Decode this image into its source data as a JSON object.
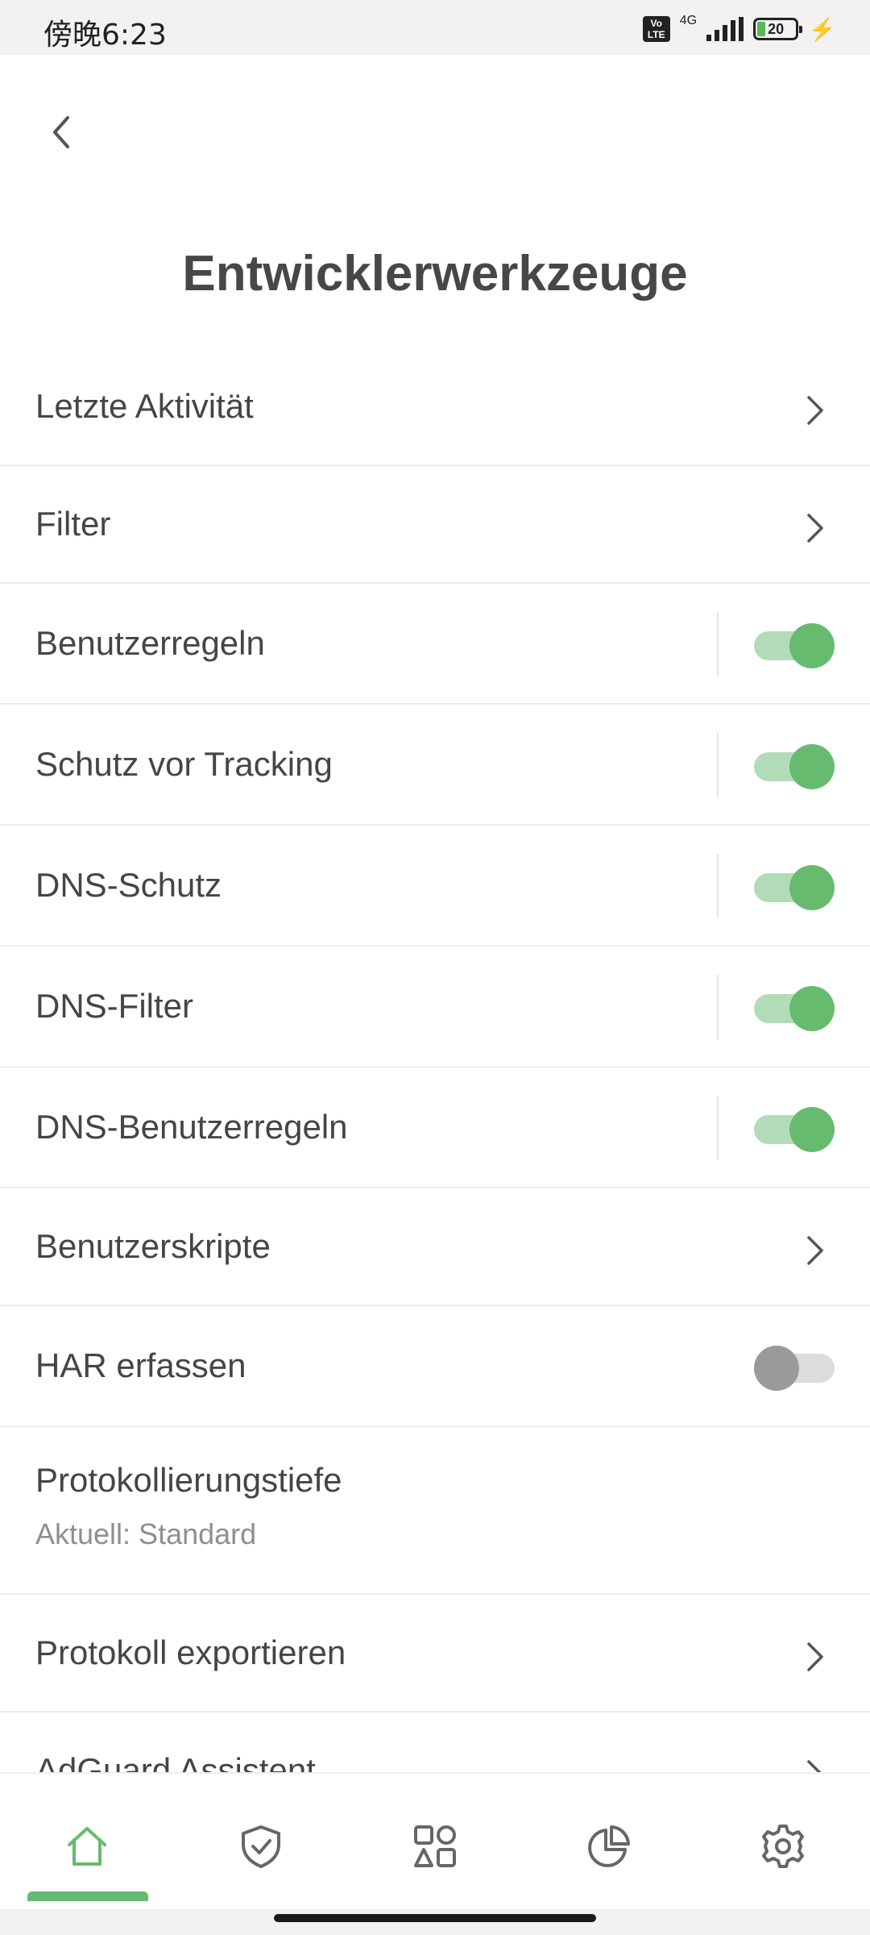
{
  "status_bar": {
    "time": "傍晚6:23",
    "volte": "Vo LTE",
    "network": "4G",
    "battery": "20"
  },
  "header": {
    "back_icon": "chevron-left-icon",
    "title": "Entwicklerwerkzeuge"
  },
  "items": [
    {
      "label": "Letzte Aktivität",
      "control": "chevron"
    },
    {
      "label": "Filter",
      "control": "chevron"
    },
    {
      "label": "Benutzerregeln",
      "control": "toggle",
      "on": true
    },
    {
      "label": "Schutz vor Tracking",
      "control": "toggle",
      "on": true
    },
    {
      "label": "DNS-Schutz",
      "control": "toggle",
      "on": true
    },
    {
      "label": "DNS-Filter",
      "control": "toggle",
      "on": true
    },
    {
      "label": "DNS-Benutzerregeln",
      "control": "toggle",
      "on": true
    },
    {
      "label": "Benutzerskripte",
      "control": "chevron"
    },
    {
      "label": "HAR erfassen",
      "control": "toggle",
      "on": false
    },
    {
      "label": "Protokollierungstiefe",
      "sublabel": "Aktuell: Standard",
      "control": "none"
    },
    {
      "label": "Protokoll exportieren",
      "control": "chevron"
    },
    {
      "label": "AdGuard Assistent",
      "control": "chevron"
    }
  ],
  "bottom_nav": [
    {
      "icon": "home-icon",
      "active": true
    },
    {
      "icon": "shield-check-icon",
      "active": false
    },
    {
      "icon": "apps-icon",
      "active": false
    },
    {
      "icon": "statistics-pie-icon",
      "active": false
    },
    {
      "icon": "gear-icon",
      "active": false
    }
  ],
  "colors": {
    "accent": "#66bb6e",
    "accent_light": "#b2dcb8",
    "text": "#454545",
    "subtext": "#8f8f8f"
  }
}
